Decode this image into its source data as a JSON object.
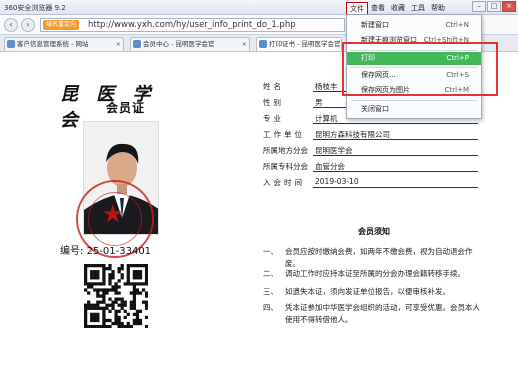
{
  "window": {
    "title": "360安全浏览器 9.2"
  },
  "menubar": {
    "items": [
      "文件",
      "查看",
      "收藏",
      "工具",
      "帮助"
    ]
  },
  "window_buttons": {
    "minimize": "–",
    "maximize": "□",
    "close": "×"
  },
  "address": {
    "redirect_tag": "域名重定向",
    "url": "http://www.yxh.com/hy/user_info_print_do_1.php"
  },
  "tabs": [
    {
      "label": "客户信息管理系统 - 网站"
    },
    {
      "label": "会员中心 - 昆明医学会官"
    },
    {
      "label": "打印证书 - 昆明医学会官"
    }
  ],
  "file_menu": {
    "items": [
      {
        "label": "新建窗口",
        "shortcut": "Ctrl+N"
      },
      {
        "label": "新建无痕浏览窗口",
        "shortcut": "Ctrl+Shift+N"
      },
      {
        "label": "打印",
        "shortcut": "Ctrl+P"
      },
      {
        "label": "保存网页...",
        "shortcut": "Ctrl+S"
      },
      {
        "label": "保存网页为图片",
        "shortcut": "Ctrl+M"
      },
      {
        "label": "关闭窗口",
        "shortcut": ""
      }
    ]
  },
  "card": {
    "calligraphy": "昆 医 学 会",
    "title": "会员证",
    "number_label": "编号:",
    "number": "25-01-33401",
    "qr_caption": ""
  },
  "fields": [
    {
      "label": "姓名",
      "value": "杨枝丰"
    },
    {
      "label": "性别",
      "value": "男"
    },
    {
      "label": "专业",
      "value": "计算机"
    },
    {
      "label": "工作单位",
      "value": "昆明方森科技有限公司"
    },
    {
      "label": "所属地方分会",
      "value": "昆明医学会"
    },
    {
      "label": "所属专科分会",
      "value": "血管分会"
    },
    {
      "label": "入会时间",
      "value": "2019-03-10"
    }
  ],
  "notice": {
    "title": "会员须知",
    "items": [
      {
        "num": "一、",
        "text": "会员应按时缴纳会费，如两年不缴会费，视为自动退会作废。"
      },
      {
        "num": "二、",
        "text": "调动工作时应持本证至所属的分会办理会籍转移手续。"
      },
      {
        "num": "三、",
        "text": "如遗失本证，须向发证单位报告，以便审核补发。"
      },
      {
        "num": "四、",
        "text": "凭本证参加中华医学会组织的活动，可享受优惠。会员本人使用不得转借他人。"
      }
    ]
  },
  "colors": {
    "menu_highlight": "#42b85a",
    "annotation_box": "#e23232",
    "seal": "#c81e1e",
    "redirect_tag": "#f29a2e"
  }
}
